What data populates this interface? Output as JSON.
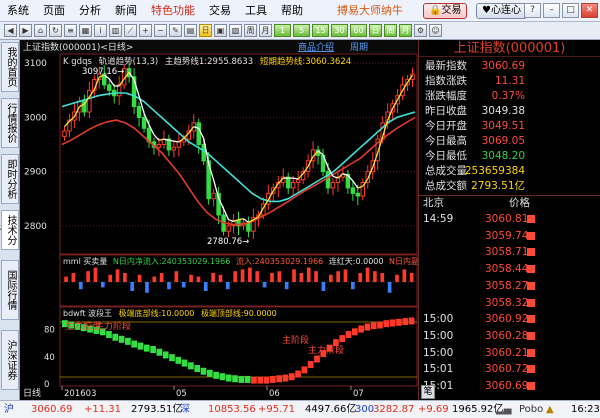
{
  "menubar": {
    "items": [
      "系统",
      "页面",
      "分析",
      "新闻",
      "特色功能",
      "交易",
      "工具",
      "帮助"
    ],
    "brand": "搏易大师纳牛",
    "trade_btn": "交易",
    "heart_btn": "心连心"
  },
  "toolbar": {
    "periods": [
      "1",
      "5",
      "15",
      "30",
      "60"
    ]
  },
  "left_tabs": [
    "我的首页",
    "行情报价",
    "即时分析",
    "技术分析",
    "国际行情",
    "沪深证券"
  ],
  "chart_header": {
    "title": "上证指数(000001)<日线>",
    "intro": "商品介绍",
    "period": "周期"
  },
  "chart_data": {
    "type": "candlestick",
    "price_pane": {
      "indicator_prefix": "K gdqs",
      "ma_label": "轨道趋势(13,3)",
      "trend_label": "主趋势线1:2955.8633",
      "short_label": "短期趋势线:3060.3624",
      "high_annot": "3097.16→",
      "low_annot": "2780.76→",
      "ylim": [
        2748,
        3117
      ],
      "y_ticks": [
        "3100",
        "3000",
        "2900",
        "2800"
      ],
      "y_tick_values": [
        3100,
        3000,
        2900,
        2800
      ],
      "close": [
        2975,
        2995,
        3010,
        3030,
        3010,
        3050,
        3070,
        3080,
        3060,
        3050,
        3040,
        3060,
        3090,
        3075,
        3020,
        3000,
        2980,
        2955,
        2945,
        2950,
        2960,
        2940,
        2945,
        2955,
        2960,
        2975,
        2990,
        2950,
        2920,
        2850,
        2860,
        2820,
        2790,
        2800,
        2810,
        2800,
        2805,
        2790,
        2815,
        2820,
        2840,
        2860,
        2870,
        2880,
        2890,
        2870,
        2880,
        2885,
        2900,
        2920,
        2940,
        2930,
        2900,
        2870,
        2880,
        2890,
        2895,
        2870,
        2860,
        2855,
        2880,
        2900,
        2920,
        2960,
        2990,
        3010,
        3025,
        3040,
        3060,
        3070,
        3080
      ],
      "cyan_trend": [
        3020,
        3025,
        3030,
        3035,
        3040,
        3043,
        3045,
        3045,
        3040,
        3030,
        3015,
        3000,
        2985,
        2970,
        2955,
        2945,
        2935,
        2920,
        2905,
        2890,
        2875,
        2860,
        2850,
        2845,
        2845,
        2850,
        2860,
        2870,
        2880,
        2890,
        2900,
        2915,
        2930,
        2945,
        2960,
        2975,
        2990,
        3000,
        3005,
        3010
      ],
      "red_trend": [
        2950,
        2958,
        2968,
        2978,
        2986,
        2992,
        2995,
        2990,
        2980,
        2965,
        2950,
        2935,
        2915,
        2895,
        2870,
        2845,
        2825,
        2812,
        2805,
        2802,
        2803,
        2808,
        2816,
        2825,
        2835,
        2845,
        2856,
        2866,
        2875,
        2885,
        2895,
        2905,
        2915,
        2925,
        2940,
        2955,
        2968,
        2980,
        2990,
        3000
      ]
    },
    "volume_pane": {
      "name": "mml 买卖量",
      "inflow": "N日内净流入:240353029.1966",
      "outflow": "流入:240353029.1966",
      "streak": "连红天:0.0000",
      "extra": "N日内副",
      "values": [
        0.3,
        0.5,
        -0.4,
        0.6,
        0.8,
        -0.3,
        0.4,
        0.7,
        0.5,
        -0.5,
        0.4,
        -0.6,
        0.3,
        0.5,
        -0.4,
        0.6,
        -0.3,
        0.4,
        0.3,
        -0.5,
        0.5,
        0.4,
        -0.4,
        0.6,
        0.7,
        0.8,
        0.6,
        -0.3,
        0.5,
        0.6,
        -0.4,
        0.7,
        0.5,
        0.8,
        0.6,
        -0.5,
        0.4,
        0.6,
        0.7,
        -0.4,
        0.5,
        0.8,
        0.6,
        0.5,
        -0.6,
        0.4,
        0.7,
        0.5
      ]
    },
    "wave_pane": {
      "name": "bdwft 波段王",
      "bottom": "极端底部线:10.0000",
      "top": "极端顶部线:90.0000",
      "annot1": "主力控盘",
      "annot2": "主力阶段",
      "annot3": "主阶段",
      "annot4": "主力阶段",
      "ylim": [
        0,
        100
      ],
      "y_ticks": [
        "80",
        "40",
        "0"
      ],
      "y_tick_values": [
        80,
        40,
        0
      ],
      "values": [
        88,
        86,
        84,
        82,
        80,
        78,
        76,
        72,
        68,
        65,
        62,
        58,
        55,
        52,
        50,
        46,
        42,
        38,
        34,
        30,
        26,
        22,
        18,
        15,
        12,
        10,
        8,
        7,
        6,
        6,
        5,
        5,
        5,
        6,
        7,
        8,
        10,
        14,
        20,
        28,
        36,
        44,
        52,
        60,
        66,
        72,
        76,
        80,
        83,
        85,
        86,
        88,
        89,
        90,
        91,
        92
      ]
    },
    "x_axis": {
      "name": "日线",
      "ticks": [
        "201603",
        "05",
        "06",
        "07"
      ]
    }
  },
  "quote": {
    "title": "上证指数(000001)",
    "rows": [
      {
        "label": "最新指数",
        "value": "3060.69",
        "color": "#ff4a3a"
      },
      {
        "label": "指数涨跌",
        "value": "11.31",
        "color": "#ff4a3a"
      },
      {
        "label": "涨跌幅度",
        "value": "0.37%",
        "color": "#ff4a3a"
      },
      {
        "label": "昨日收盘",
        "value": "3049.38",
        "color": "#e0e0e0"
      },
      {
        "label": "今日开盘",
        "value": "3049.51",
        "color": "#ff4a3a"
      },
      {
        "label": "今日最高",
        "value": "3069.05",
        "color": "#ff4a3a"
      },
      {
        "label": "今日最低",
        "value": "3048.20",
        "color": "#30d040"
      },
      {
        "label": "总成交量",
        "value": "253659384",
        "color": "#ffd400"
      },
      {
        "label": "总成交额",
        "value": "2793.51亿",
        "color": "#ffd400"
      }
    ]
  },
  "ticks": {
    "header_left": "北京",
    "header_right": "价格",
    "tab": "笔",
    "rows": [
      {
        "time": "14:59",
        "price": "3060.81"
      },
      {
        "time": "",
        "price": "3059.74"
      },
      {
        "time": "",
        "price": "3058.71"
      },
      {
        "time": "",
        "price": "3058.44"
      },
      {
        "time": "",
        "price": "3058.27"
      },
      {
        "time": "",
        "price": "3058.32"
      },
      {
        "time": "15:00",
        "price": "3060.92"
      },
      {
        "time": "15:00",
        "price": "3060.28"
      },
      {
        "time": "15:00",
        "price": "3060.21"
      },
      {
        "time": "15:01",
        "price": "3060.72"
      },
      {
        "time": "15:01",
        "price": "3060.69"
      }
    ]
  },
  "status": {
    "sh_label": "沪",
    "sh_price": "3060.69",
    "sh_change": "+11.31",
    "sh_amount": "2793.51亿",
    "sz_label": "深",
    "sz_price": "10853.56",
    "sz_change": "+95.71",
    "sz_amount": "4497.66亿",
    "c3_label": "300",
    "c3_price": "3282.87",
    "c3_change": "+9.69",
    "c3_amount": "1965.92亿",
    "brand": "Pobo",
    "time": "16:23"
  }
}
